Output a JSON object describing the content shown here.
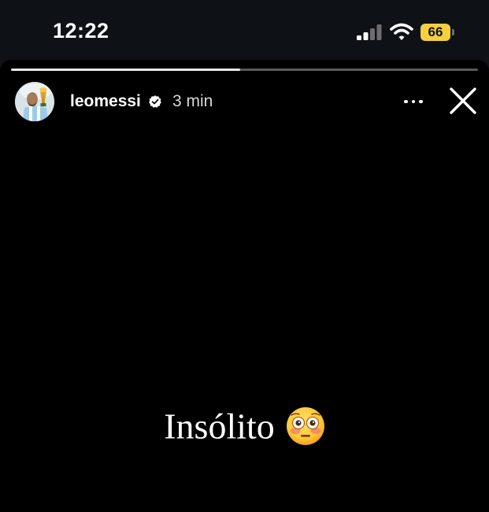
{
  "status_bar": {
    "time": "12:22",
    "battery_level": "66",
    "signal_bars_active": 2,
    "signal_bars_total": 4,
    "icons": [
      "signal-icon",
      "wifi-icon",
      "battery-icon"
    ]
  },
  "story": {
    "progress": 0.49,
    "username": "leomessi",
    "verified": true,
    "time_ago": "3 min",
    "caption": "Insólito",
    "caption_emoji": "flushed-face-emoji",
    "icons": [
      "more-options-icon",
      "close-icon",
      "verified-badge-icon"
    ],
    "colors": {
      "background": "#000000",
      "status_bar_background": "#0e1116",
      "battery": "#f4d03f",
      "verified_badge": "#ffffff"
    }
  }
}
